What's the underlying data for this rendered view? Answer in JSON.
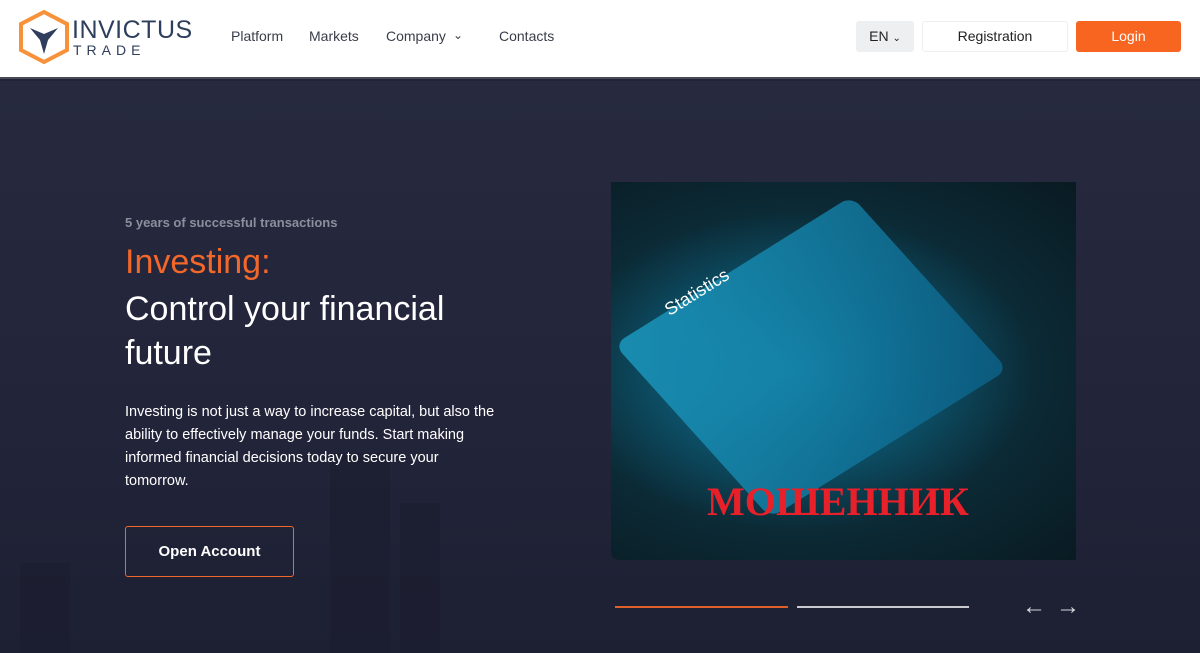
{
  "header": {
    "logo": {
      "line1": "INVICTUS",
      "line2": "TRADE"
    },
    "nav": [
      {
        "label": "Platform"
      },
      {
        "label": "Markets"
      },
      {
        "label": "Company",
        "has_dropdown": true
      },
      {
        "label": "Contacts"
      }
    ],
    "language": "EN",
    "registration_label": "Registration",
    "login_label": "Login"
  },
  "hero": {
    "subtitle": "5 years of successful transactions",
    "title_accent": "Investing:",
    "title": "Control your financial future",
    "description": "Investing is not just a way to increase capital, but also the ability to effectively manage your funds. Start making informed financial decisions today to secure your tomorrow.",
    "cta_label": "Open Account",
    "image_text": "Statistics",
    "watermark": "МОШЕННИК",
    "slider": {
      "current": 1,
      "total": 2
    }
  },
  "colors": {
    "accent": "#f86521",
    "background": "#22233a",
    "watermark": "#e8202a"
  }
}
